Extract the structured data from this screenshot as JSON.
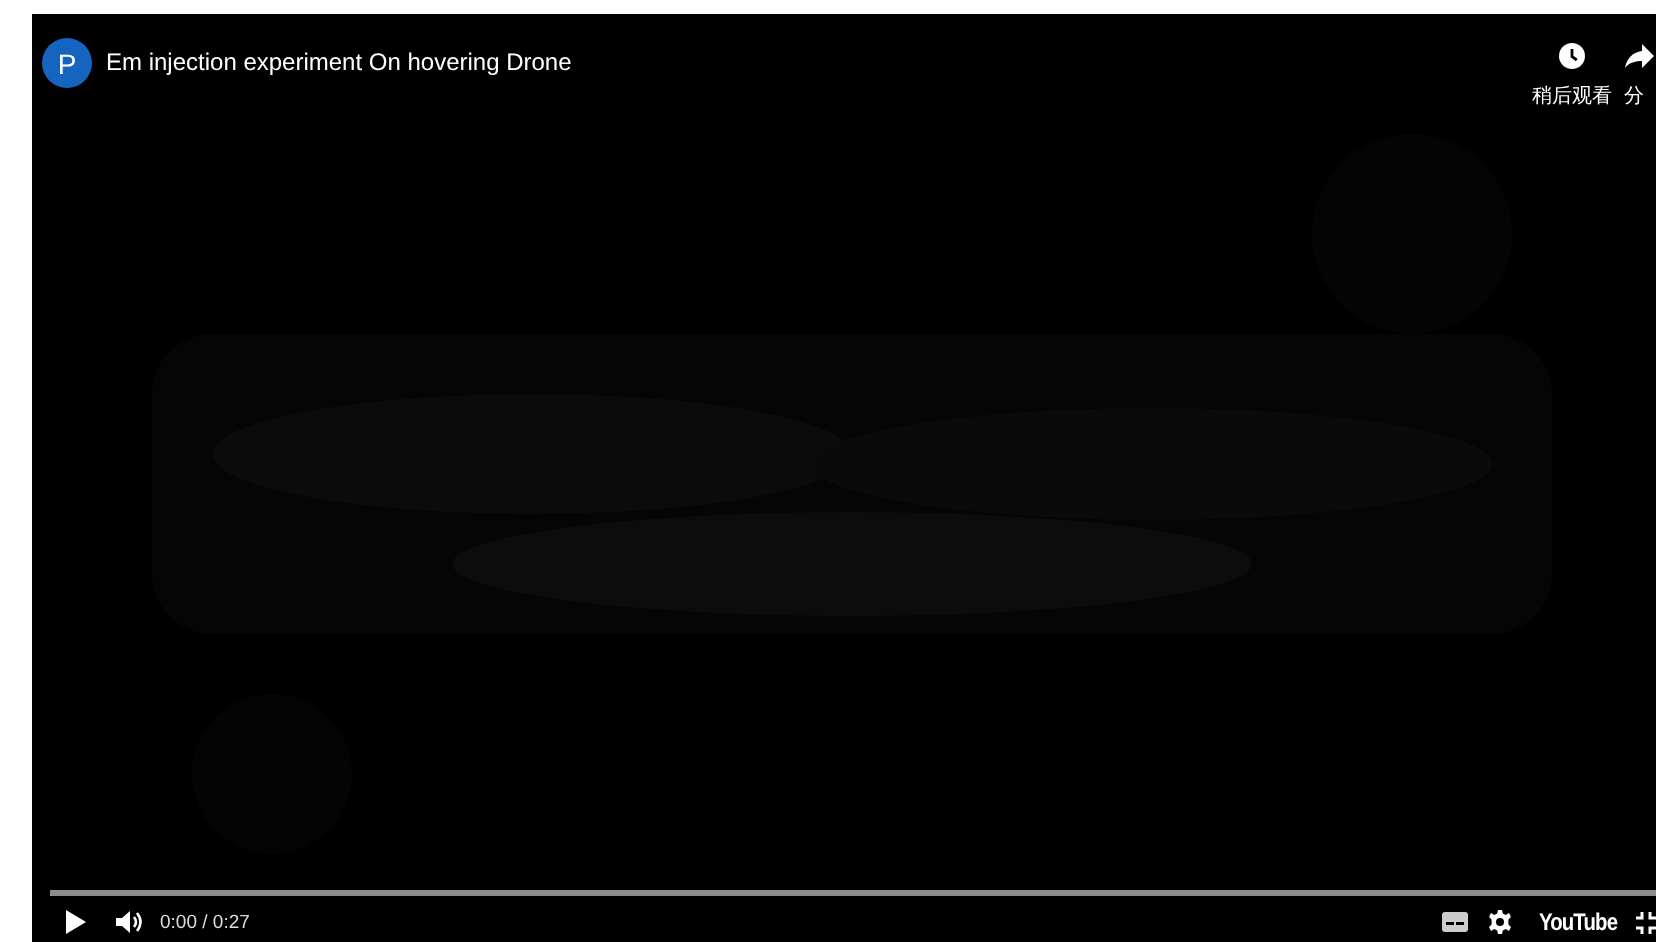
{
  "video": {
    "channel_initial": "P",
    "title": "Em injection experiment On hovering Drone"
  },
  "top_actions": [
    {
      "kind": "clock",
      "label": "稍后观看"
    },
    {
      "kind": "share",
      "label": "分"
    }
  ],
  "controls": {
    "time": "0:00 / 0:27",
    "logo": "YouTube"
  }
}
